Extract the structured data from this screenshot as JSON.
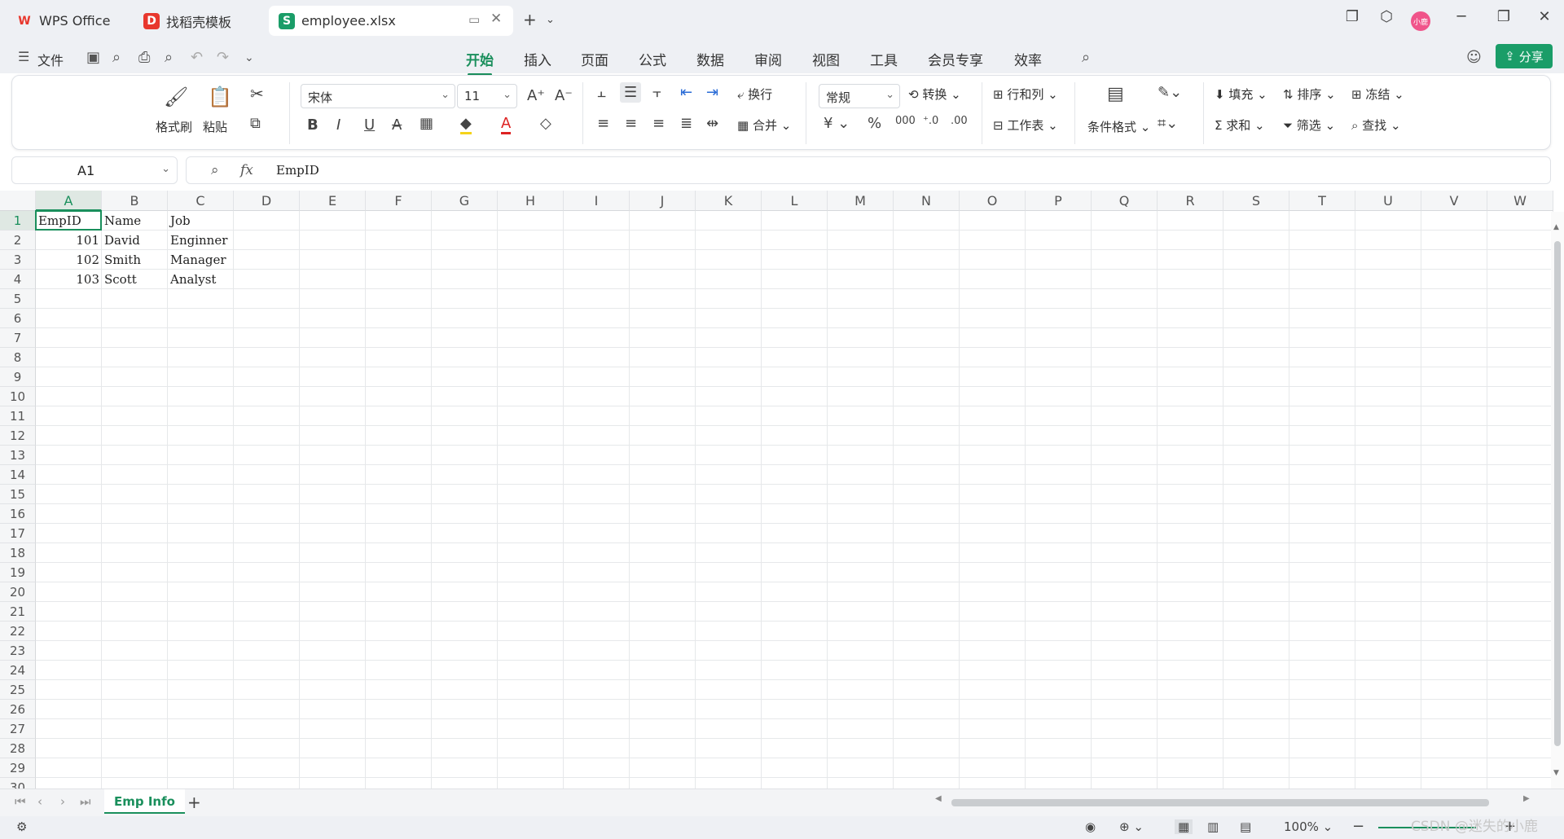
{
  "tabs": [
    {
      "label": "WPS Office",
      "logo": "W",
      "logo_color": "#e8372d"
    },
    {
      "label": "找稻壳模板",
      "logo": "D",
      "logo_color": "#e8372d"
    },
    {
      "label": "employee.xlsx",
      "logo": "S",
      "logo_color": "#1a9d68"
    }
  ],
  "menu": {
    "file_label": "文件",
    "items": [
      "开始",
      "插入",
      "页面",
      "公式",
      "数据",
      "审阅",
      "视图",
      "工具",
      "会员专享",
      "效率"
    ],
    "active": "开始",
    "share_label": "分享"
  },
  "avatar_text": "小鹿",
  "ribbon": {
    "format_painter": "格式刷",
    "paste": "粘贴",
    "font_name": "宋体",
    "font_size": "11",
    "wrap": "换行",
    "merge": "合并",
    "number_format": "常规",
    "convert": "转换",
    "rows_cols": "行和列",
    "worksheet": "工作表",
    "cond_format": "条件格式",
    "fill": "填充",
    "sum": "求和",
    "sort": "排序",
    "filter": "筛选",
    "freeze": "冻结",
    "find": "查找",
    "currency_symbol": "¥",
    "percent_symbol": "%"
  },
  "name_box": "A1",
  "formula": {
    "fx": "fx",
    "value": "EmpID"
  },
  "columns": [
    "A",
    "B",
    "C",
    "D",
    "E",
    "F",
    "G",
    "H",
    "I",
    "J",
    "K",
    "L",
    "M",
    "N",
    "O",
    "P",
    "Q",
    "R",
    "S",
    "T",
    "U",
    "V",
    "W"
  ],
  "rows": [
    "1",
    "2",
    "3",
    "4",
    "5",
    "6",
    "7",
    "8",
    "9",
    "10",
    "11",
    "12",
    "13",
    "14",
    "15",
    "16",
    "17",
    "18",
    "19",
    "20",
    "21",
    "22",
    "23",
    "24",
    "25",
    "26",
    "27",
    "28",
    "29",
    "30"
  ],
  "cells": {
    "A1": "EmpID",
    "B1": "Name",
    "C1": "Job",
    "A2": "101",
    "B2": "David",
    "C2": "Enginner",
    "A3": "102",
    "B3": "Smith",
    "C3": "Manager",
    "A4": "103",
    "B4": "Scott",
    "C4": "Analyst"
  },
  "sheet_tab": "Emp Info",
  "status": {
    "zoom": "100%"
  },
  "watermark": "CSDN @迷失的小鹿",
  "colors": {
    "accent": "#1a8f5c",
    "share": "#1a9d68"
  }
}
